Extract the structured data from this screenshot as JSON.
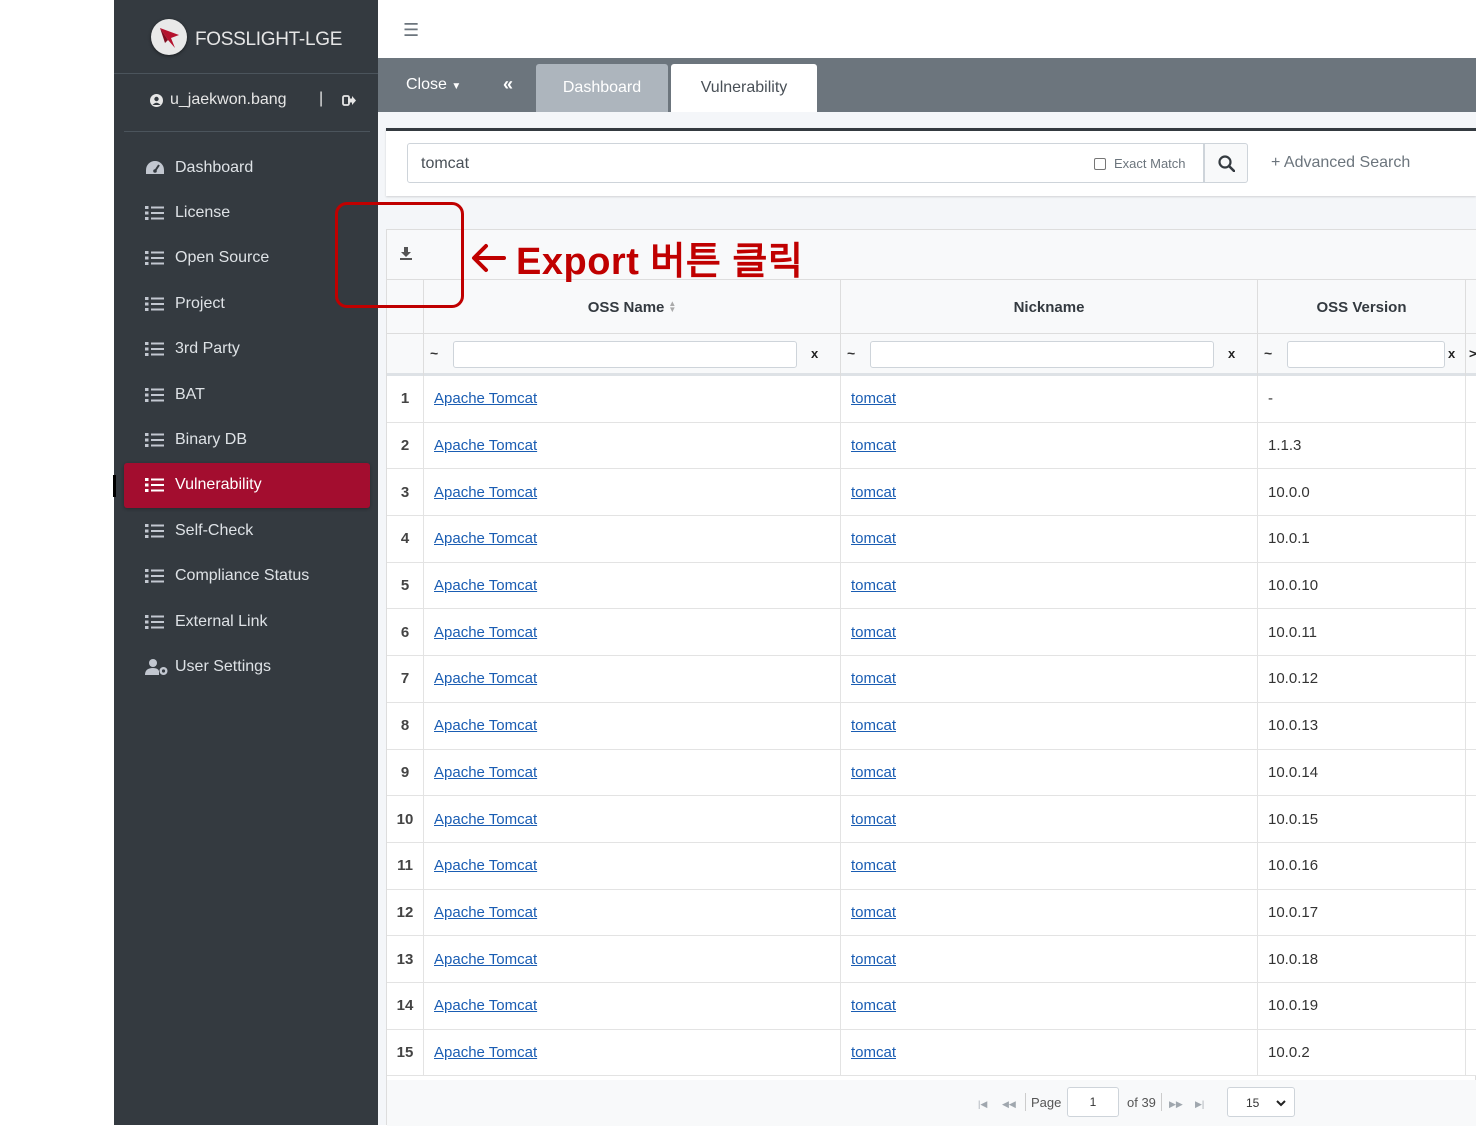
{
  "brand": {
    "name": "FOSSLIGHT-LGE"
  },
  "user": {
    "name": "u_jaekwon.bang",
    "separator": "|"
  },
  "sidebar": {
    "items": [
      {
        "label": "Dashboard",
        "icon": "dashboard-icon",
        "active": false
      },
      {
        "label": "License",
        "icon": "list-icon",
        "active": false
      },
      {
        "label": "Open Source",
        "icon": "list-icon",
        "active": false
      },
      {
        "label": "Project",
        "icon": "list-icon",
        "active": false
      },
      {
        "label": "3rd Party",
        "icon": "list-icon",
        "active": false
      },
      {
        "label": "BAT",
        "icon": "list-icon",
        "active": false
      },
      {
        "label": "Binary DB",
        "icon": "list-icon",
        "active": false
      },
      {
        "label": "Vulnerability",
        "icon": "list-icon",
        "active": true
      },
      {
        "label": "Self-Check",
        "icon": "list-icon",
        "active": false
      },
      {
        "label": "Compliance Status",
        "icon": "list-icon",
        "active": false
      },
      {
        "label": "External Link",
        "icon": "list-icon",
        "active": false
      },
      {
        "label": "User Settings",
        "icon": "user-cog-icon",
        "active": false
      }
    ]
  },
  "topbar": {
    "menu_icon": "hamburger-icon"
  },
  "tabbar": {
    "close_label": "Close",
    "collapse_icon": "double-chevron-left-icon",
    "tabs": [
      {
        "label": "Dashboard",
        "active": false
      },
      {
        "label": "Vulnerability",
        "active": true
      }
    ]
  },
  "search": {
    "value": "tomcat",
    "exact_match_label": "Exact Match",
    "exact_match_checked": false,
    "advanced_label": "+ Advanced Search"
  },
  "grid": {
    "columns": [
      "OSS Name",
      "Nickname",
      "OSS Version"
    ],
    "filter_prefix": "~",
    "filter_clear": "x",
    "filter_more": ">",
    "rows": [
      {
        "num": "1",
        "name": "Apache Tomcat",
        "nickname": "tomcat",
        "version": "-"
      },
      {
        "num": "2",
        "name": "Apache Tomcat",
        "nickname": "tomcat",
        "version": "1.1.3"
      },
      {
        "num": "3",
        "name": "Apache Tomcat",
        "nickname": "tomcat",
        "version": "10.0.0"
      },
      {
        "num": "4",
        "name": "Apache Tomcat",
        "nickname": "tomcat",
        "version": "10.0.1"
      },
      {
        "num": "5",
        "name": "Apache Tomcat",
        "nickname": "tomcat",
        "version": "10.0.10"
      },
      {
        "num": "6",
        "name": "Apache Tomcat",
        "nickname": "tomcat",
        "version": "10.0.11"
      },
      {
        "num": "7",
        "name": "Apache Tomcat",
        "nickname": "tomcat",
        "version": "10.0.12"
      },
      {
        "num": "8",
        "name": "Apache Tomcat",
        "nickname": "tomcat",
        "version": "10.0.13"
      },
      {
        "num": "9",
        "name": "Apache Tomcat",
        "nickname": "tomcat",
        "version": "10.0.14"
      },
      {
        "num": "10",
        "name": "Apache Tomcat",
        "nickname": "tomcat",
        "version": "10.0.15"
      },
      {
        "num": "11",
        "name": "Apache Tomcat",
        "nickname": "tomcat",
        "version": "10.0.16"
      },
      {
        "num": "12",
        "name": "Apache Tomcat",
        "nickname": "tomcat",
        "version": "10.0.17"
      },
      {
        "num": "13",
        "name": "Apache Tomcat",
        "nickname": "tomcat",
        "version": "10.0.18"
      },
      {
        "num": "14",
        "name": "Apache Tomcat",
        "nickname": "tomcat",
        "version": "10.0.19"
      },
      {
        "num": "15",
        "name": "Apache Tomcat",
        "nickname": "tomcat",
        "version": "10.0.2"
      }
    ]
  },
  "pager": {
    "page_label": "Page",
    "current_page": "1",
    "of_label": "of 39",
    "page_size": "15"
  },
  "annotation": {
    "text": "Export 버튼 클릭",
    "color": "#c00000"
  },
  "colors": {
    "sidebar_bg": "#343a40",
    "active_item": "#a30d2f",
    "tabbar_bg": "#6c757d",
    "link": "#1a5db3"
  }
}
